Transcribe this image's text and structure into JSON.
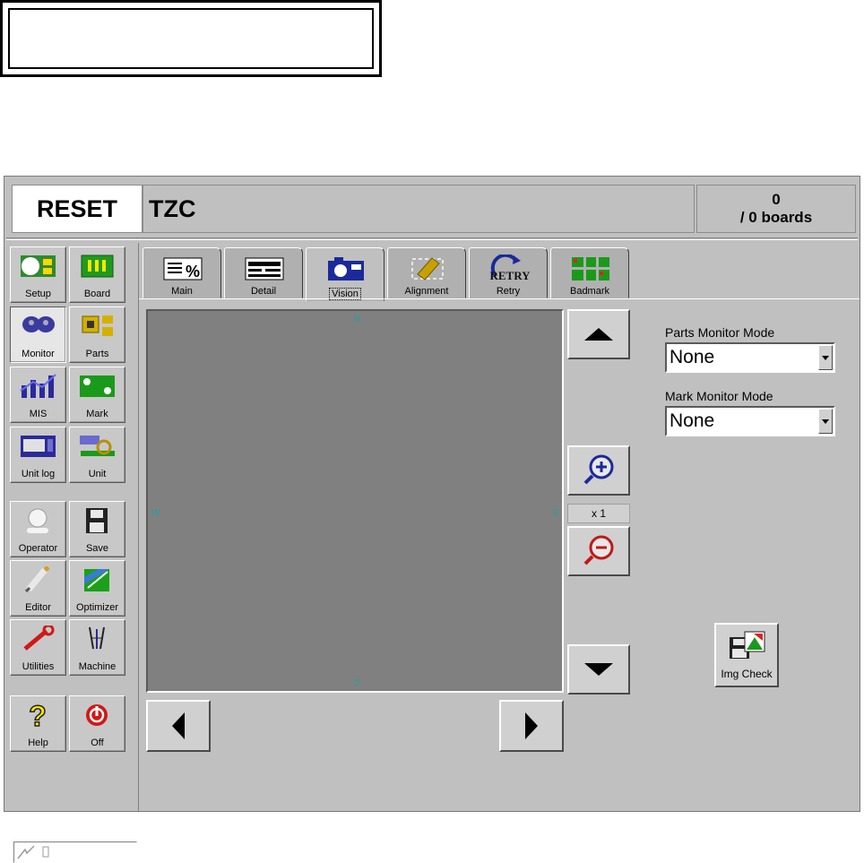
{
  "header": {
    "status": "RESET",
    "title": "TZC",
    "count": "0",
    "count_sub": "/ 0 boards"
  },
  "left_menu": [
    {
      "label": "Setup",
      "icon": "setup-icon"
    },
    {
      "label": "Board",
      "icon": "board-icon"
    },
    {
      "label": "Monitor",
      "icon": "monitor-icon",
      "active": true
    },
    {
      "label": "Parts",
      "icon": "parts-icon"
    },
    {
      "label": "MIS",
      "icon": "mis-icon"
    },
    {
      "label": "Mark",
      "icon": "mark-icon"
    },
    {
      "label": "Unit log",
      "icon": "unit-log-icon"
    },
    {
      "label": "Unit",
      "icon": "unit-icon"
    },
    {
      "label": "Operator",
      "icon": "operator-icon"
    },
    {
      "label": "Save",
      "icon": "save-icon"
    },
    {
      "label": "Editor",
      "icon": "editor-icon"
    },
    {
      "label": "Optimizer",
      "icon": "optimizer-icon"
    },
    {
      "label": "Utilities",
      "icon": "utilities-icon"
    },
    {
      "label": "Machine",
      "icon": "machine-icon"
    },
    {
      "label": "Help",
      "icon": "help-icon"
    },
    {
      "label": "Off",
      "icon": "power-off-icon"
    }
  ],
  "tabs": [
    {
      "label": "Main",
      "icon": "main-icon"
    },
    {
      "label": "Detail",
      "icon": "detail-icon"
    },
    {
      "label": "Vision",
      "icon": "camera-icon",
      "active": true
    },
    {
      "label": "Alignment",
      "icon": "alignment-icon"
    },
    {
      "label": "Retry",
      "icon": "retry-icon",
      "icon_text": "RETRY"
    },
    {
      "label": "Badmark",
      "icon": "badmark-icon"
    }
  ],
  "vision": {
    "compass": {
      "n": "N",
      "s": "S",
      "e": "E",
      "w": "W"
    },
    "zoom": "x 1"
  },
  "monitor": {
    "parts_label": "Parts Monitor Mode",
    "parts_value": "None",
    "mark_label": "Mark Monitor Mode",
    "mark_value": "None",
    "img_check_label": "Img Check"
  },
  "colors": {
    "window_bg": "#c0c0c0",
    "vision_bg": "#808080",
    "compass": "#1aa3a3"
  }
}
